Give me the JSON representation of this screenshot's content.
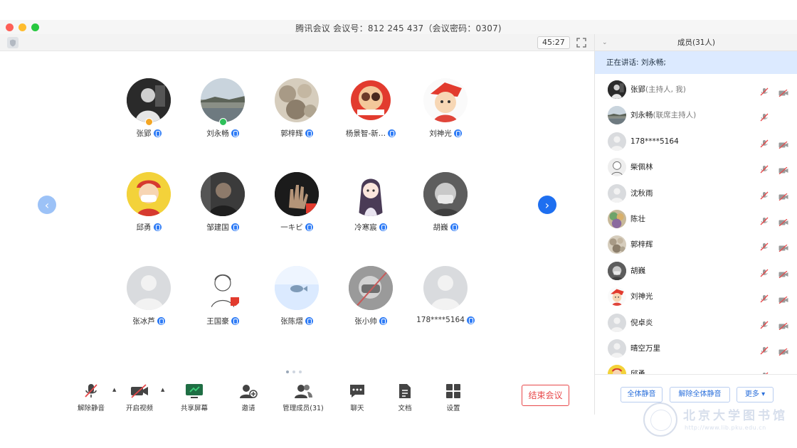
{
  "window": {
    "title": "腾讯会议 会议号：812 245 437（会议密码：0307)",
    "timer": "45:27"
  },
  "gallery": {
    "participants": [
      {
        "name": "张郢",
        "avatar": "bw-portrait",
        "host_mark": "#f4a623"
      },
      {
        "name": "刘永畅",
        "avatar": "landscape",
        "host_mark": "#2ec05a"
      },
      {
        "name": "郭梓辉",
        "avatar": "rocks"
      },
      {
        "name": "杨景智-新…",
        "avatar": "red-badge"
      },
      {
        "name": "刘神光",
        "avatar": "cartoon-boy"
      },
      {
        "name": "邱勇",
        "avatar": "yellow-mask"
      },
      {
        "name": "邹建国",
        "avatar": "dark-man"
      },
      {
        "name": "一キビ",
        "avatar": "hand"
      },
      {
        "name": "冷寒宸",
        "avatar": "anime-girl"
      },
      {
        "name": "胡巍",
        "avatar": "masked-grey"
      },
      {
        "name": "张冰芦",
        "avatar": "default"
      },
      {
        "name": "王国豪",
        "avatar": "sketch-man"
      },
      {
        "name": "张陈熠",
        "avatar": "blue-fish"
      },
      {
        "name": "张小帅",
        "avatar": "photo-grey"
      },
      {
        "name": "178****5164",
        "avatar": "default"
      }
    ]
  },
  "controls": {
    "unmute": "解除静音",
    "start_video": "开启视频",
    "share_screen": "共享屏幕",
    "invite": "邀请",
    "manage_members": "管理成员(31)",
    "chat": "聊天",
    "docs": "文档",
    "settings": "设置",
    "end_meeting": "结束会议"
  },
  "panel": {
    "title": "成员(31人)",
    "speaking": "正在讲话: 刘永畅;",
    "members": [
      {
        "name": "张郢",
        "role": "(主持人, 我)",
        "avatar": "bw-portrait",
        "cam": true
      },
      {
        "name": "刘永畅",
        "role": "(联席主持人)",
        "avatar": "landscape",
        "cam": false
      },
      {
        "name": "178****5164",
        "role": "",
        "avatar": "default",
        "cam": true
      },
      {
        "name": "柴佩林",
        "role": "",
        "avatar": "sketch-small",
        "cam": true
      },
      {
        "name": "沈秋雨",
        "role": "",
        "avatar": "default",
        "cam": true
      },
      {
        "name": "陈壮",
        "role": "",
        "avatar": "colorful",
        "cam": true
      },
      {
        "name": "郭梓辉",
        "role": "",
        "avatar": "rocks",
        "cam": true
      },
      {
        "name": "胡巍",
        "role": "",
        "avatar": "masked-grey",
        "cam": true
      },
      {
        "name": "刘神光",
        "role": "",
        "avatar": "cartoon-boy",
        "cam": true
      },
      {
        "name": "倪卓炎",
        "role": "",
        "avatar": "default",
        "cam": true
      },
      {
        "name": "晴空万里",
        "role": "",
        "avatar": "default",
        "cam": true
      },
      {
        "name": "邱勇",
        "role": "",
        "avatar": "yellow-mask",
        "cam": true
      }
    ],
    "mute_all": "全体静音",
    "unmute_all": "解除全体静音",
    "more": "更多 ▾"
  },
  "watermark": {
    "text": "北京大学图书馆",
    "url": "http://www.lib.pku.edu.cn"
  },
  "colors": {
    "accent": "#2f7cf6",
    "speaking_bg": "#dceaff",
    "end_red": "#e8484a"
  }
}
